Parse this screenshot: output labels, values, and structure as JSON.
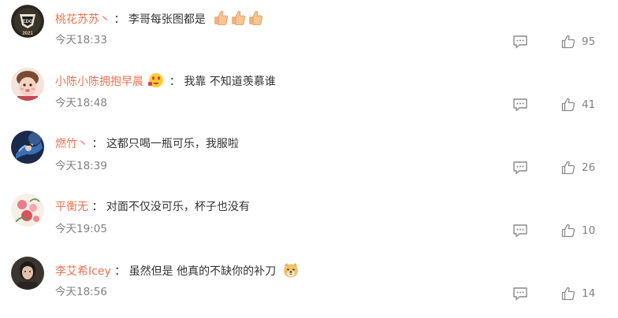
{
  "separator": "：",
  "comments": [
    {
      "username": "桃花苏苏丶",
      "avatar_icon": "edg-logo-avatar",
      "avatar_text": "EDG 2021",
      "text": "李哥每张图都是",
      "emoji": "thumbs-up-emoji x3",
      "time": "今天18:33",
      "likes": "95"
    },
    {
      "username": "小陈小陈拥抱早晨",
      "avatar_icon": "child-photo-avatar",
      "badge_icon": "heart-eyes-badge-icon",
      "text": "我靠 不知道羡慕谁",
      "time": "今天18:48",
      "likes": "41"
    },
    {
      "username": "燃竹丶",
      "avatar_icon": "anime-character-avatar",
      "text": "这都只喝一瓶可乐，我服啦",
      "time": "今天18:39",
      "likes": "26"
    },
    {
      "username": "平衡无",
      "avatar_icon": "floral-artwork-avatar",
      "text": "对面不仅没可乐，杯子也没有",
      "time": "今天19:05",
      "likes": "10"
    },
    {
      "username": "李艾希Icey",
      "avatar_icon": "person-photo-avatar",
      "text": "虽然但是 他真的不缺你的补刀",
      "emoji": "doge-emoji",
      "time": "今天18:56",
      "likes": "14"
    }
  ],
  "colors": {
    "username": "#eb7350",
    "text": "#333333",
    "meta": "#808080"
  }
}
